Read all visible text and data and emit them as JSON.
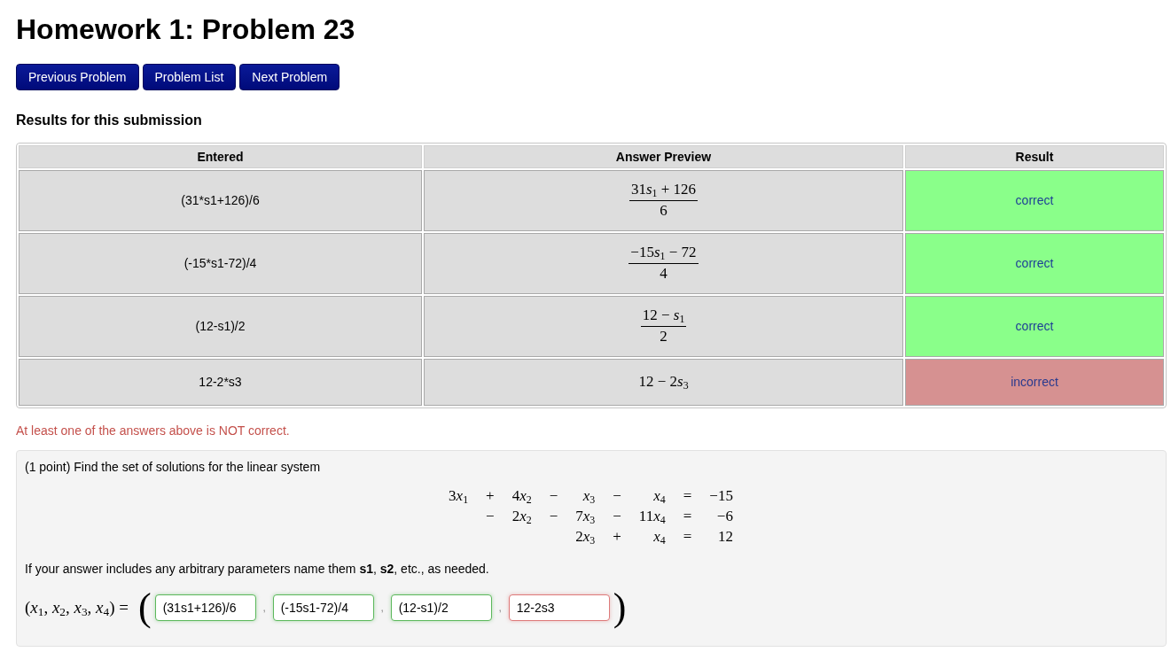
{
  "page": {
    "title": "Homework 1: Problem 23"
  },
  "nav_buttons": [
    "Previous Problem",
    "Problem List",
    "Next Problem"
  ],
  "results": {
    "title": "Results for this submission",
    "columns": [
      "Entered",
      "Answer Preview",
      "Result"
    ],
    "rows": [
      {
        "entered": "(31*s1+126)/6",
        "preview": {
          "kind": "fraction",
          "numerator": "31s$_{1}$ + 126",
          "denominator": "6"
        },
        "result": {
          "text": "correct",
          "correct": true
        }
      },
      {
        "entered": "(-15*s1-72)/4",
        "preview": {
          "kind": "fraction",
          "numerator": "−15s$_{1}$ − 72",
          "denominator": "4"
        },
        "result": {
          "text": "correct",
          "correct": true
        }
      },
      {
        "entered": "(12-s1)/2",
        "preview": {
          "kind": "fraction",
          "numerator": "12 − s$_{1}$",
          "denominator": "2"
        },
        "result": {
          "text": "correct",
          "correct": true
        }
      },
      {
        "entered": "12-2*s3",
        "preview": {
          "kind": "inline",
          "text": "12 − 2s$_{3}$"
        },
        "result": {
          "text": "incorrect",
          "correct": false
        }
      }
    ]
  },
  "message": "At least one of the answers above is NOT correct.",
  "problem": {
    "intro": "(1 point) Find the set of solutions for the linear system",
    "system": [
      {
        "cells": [
          "3x$_{1}$",
          "+",
          "4x$_{2}$",
          "−",
          "x$_{3}$",
          "−",
          "x$_{4}$",
          "=",
          "−15"
        ]
      },
      {
        "cells": [
          null,
          "−",
          "2x$_{2}$",
          "−",
          "7x$_{3}$",
          "−",
          "11x$_{4}$",
          "=",
          "−6"
        ]
      },
      {
        "cells": [
          null,
          null,
          null,
          null,
          "2x$_{3}$",
          "+",
          "x$_{4}$",
          "=",
          "12"
        ]
      }
    ],
    "hint": "If your answer includes any arbitrary parameters name them **s1**, **s2**, etc., as needed.",
    "answer": {
      "label": "(x$_{1}$, x$_{2}$, x$_{3}$, x$_{4}$) =",
      "open": "(",
      "close": ")",
      "fields": [
        {
          "value": "(31s1+126)/6",
          "correct": true
        },
        {
          "separator": ",",
          "value": "(-15s1-72)/4",
          "correct": true
        },
        {
          "separator": ",",
          "value": "(12-s1)/2",
          "correct": true
        },
        {
          "separator": ",",
          "value": "12-2s3",
          "correct": false
        }
      ]
    }
  }
}
